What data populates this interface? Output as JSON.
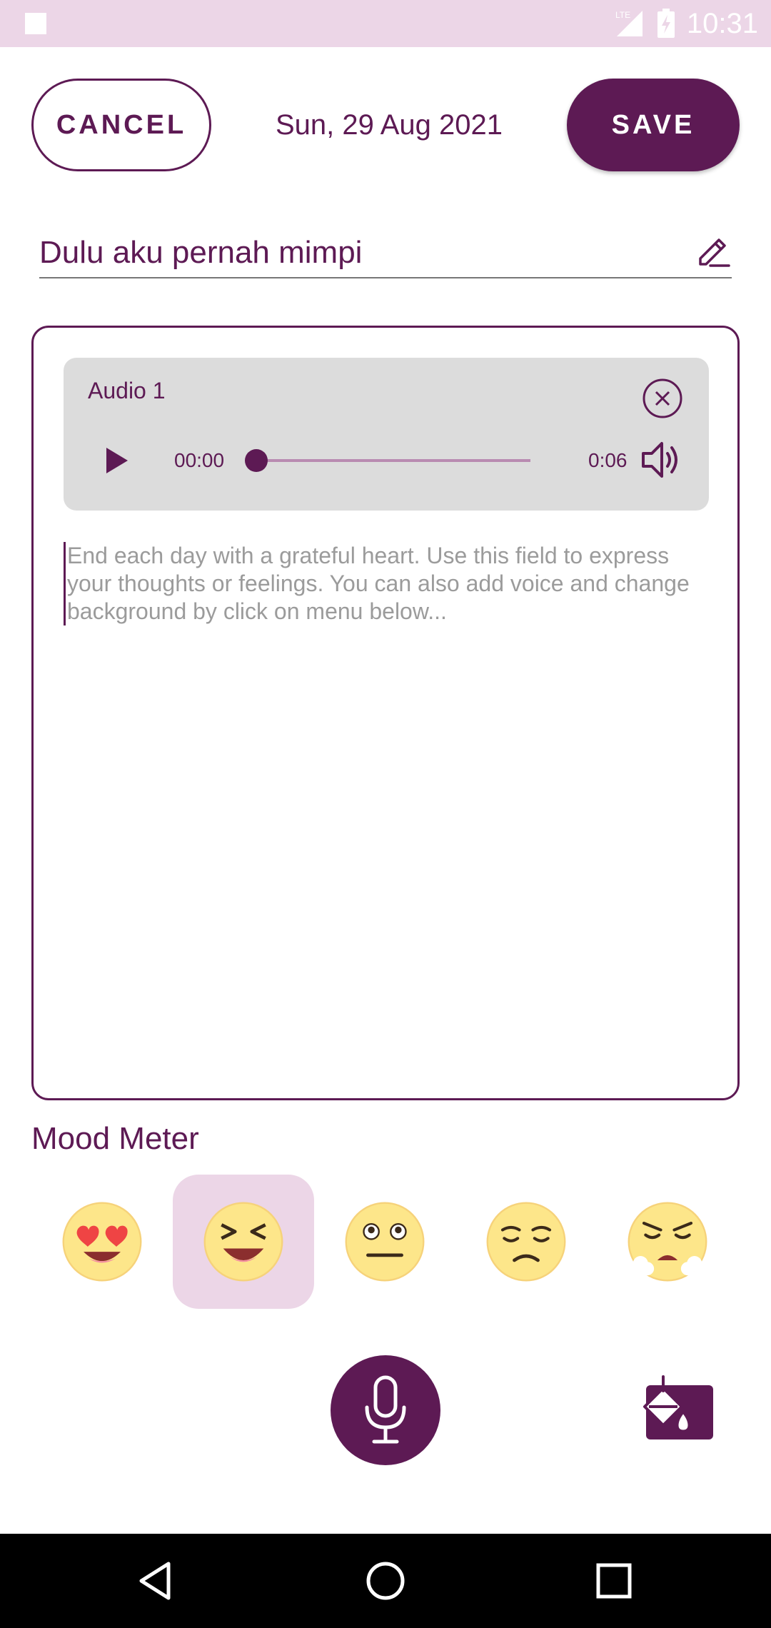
{
  "status_bar": {
    "network_label": "LTE",
    "time": "10:31"
  },
  "header": {
    "cancel_label": "CANCEL",
    "date": "Sun, 29 Aug 2021",
    "save_label": "SAVE"
  },
  "title_field": {
    "value": "Dulu aku pernah mimpi",
    "icon": "pencil-icon"
  },
  "audio": {
    "title": "Audio 1",
    "current_time": "00:00",
    "total_time": "0:06",
    "progress": 0
  },
  "entry": {
    "placeholder": "End each day with a grateful heart. Use this field to express your thoughts or feelings. You can also add voice and change background by click on menu below..."
  },
  "mood": {
    "label": "Mood Meter",
    "options": [
      "heart-eyes-face-icon",
      "grinning-squinting-face-icon",
      "neutral-face-icon",
      "pensive-face-icon",
      "angry-steaming-face-icon"
    ],
    "selected_index": 1
  },
  "actions": {
    "mic_icon": "microphone-icon",
    "background_icon": "paint-bucket-icon"
  },
  "colors": {
    "primary": "#5d1a54",
    "primary_light": "#ecd6e7",
    "audio_card_bg": "#dcdcdc",
    "emoji_yellow": "#fde68a"
  }
}
